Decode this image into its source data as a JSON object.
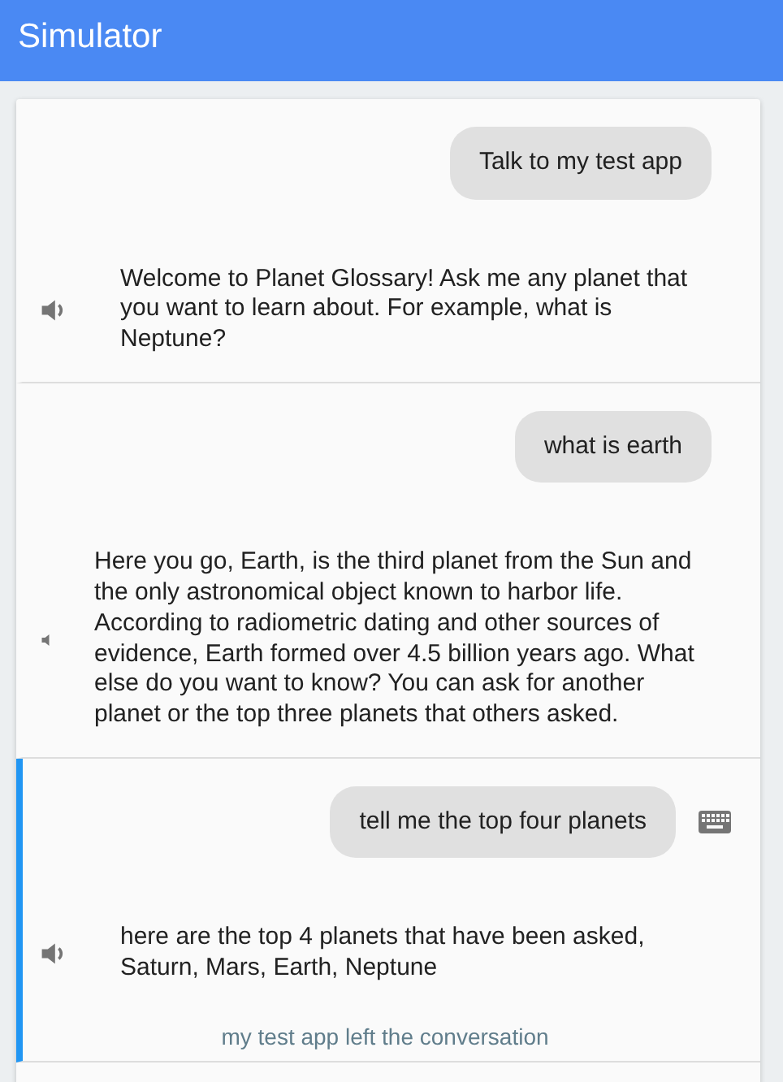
{
  "header": {
    "title": "Simulator"
  },
  "turns": [
    {
      "user": "Talk to my test app",
      "reply": "Welcome to Planet Glossary! Ask me any planet that you want to learn about. For example, what is Neptune?",
      "sound_waves": true,
      "selected": false,
      "keyboard": false
    },
    {
      "user": "what is earth",
      "reply": "Here you go, Earth, is the third planet from the Sun and the only astronomical object known to harbor life. According to radiometric dating and other sources of evidence, Earth formed over 4.5 billion years ago. What else do you want to know? You can ask for another planet or the top three planets that others asked.",
      "sound_waves": false,
      "selected": false,
      "keyboard": false
    },
    {
      "user": "tell me the top four planets",
      "reply": "here are the top 4 planets that have been asked, Saturn, Mars, Earth, Neptune",
      "sound_waves": true,
      "selected": true,
      "keyboard": true,
      "notice": "my test app left the conversation"
    }
  ]
}
